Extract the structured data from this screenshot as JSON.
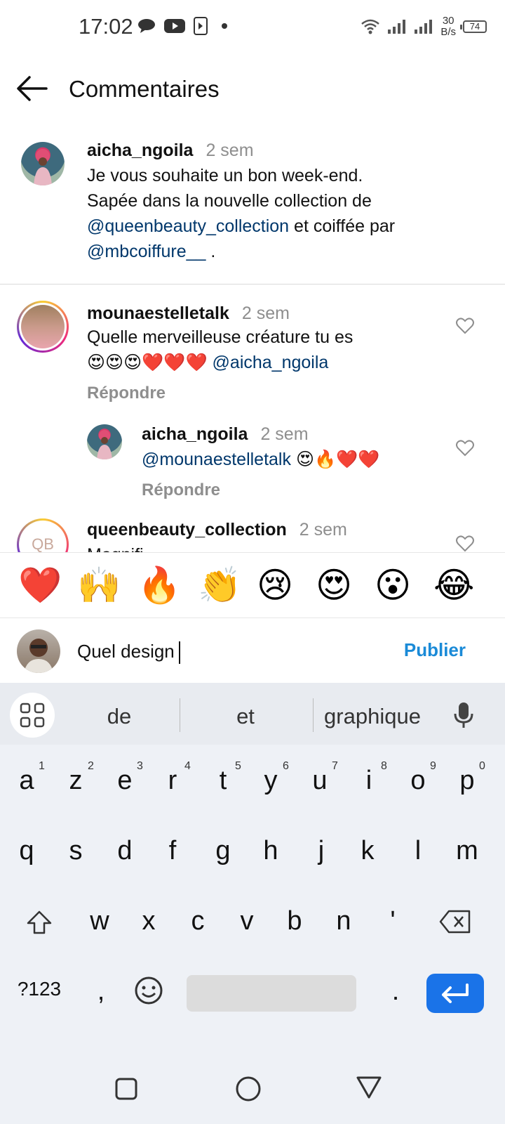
{
  "status": {
    "time": "17:02",
    "speed_top": "30",
    "speed_unit": "B/s",
    "battery": "74"
  },
  "header": {
    "title": "Commentaires"
  },
  "caption": {
    "username": "aicha_ngoila",
    "time": "2 sem",
    "line1": "Je vous souhaite un bon week-end.",
    "line2": "Sapée dans la nouvelle collection de",
    "mention1": "@queenbeauty_collection",
    "mid": " et coiffée par",
    "mention2": "@mbcoiffure__",
    "end": " ."
  },
  "comments": [
    {
      "username": "mounaestelletalk",
      "time": "2 sem",
      "text": "Quelle merveilleuse créature tu es",
      "emojis": "😍😍😍❤️❤️❤️",
      "mention": "@aicha_ngoila",
      "reply": "Répondre"
    },
    {
      "username": "aicha_ngoila",
      "time": "2 sem",
      "mention": "@mounaestelletalk",
      "emojis": "😍🔥❤️❤️",
      "reply": "Répondre"
    },
    {
      "username": "queenbeauty_collection",
      "time": "2 sem",
      "text": "Magnifi..."
    }
  ],
  "emoji_bar": [
    "❤️",
    "🙌",
    "🔥",
    "👏",
    "😢",
    "😍",
    "😮",
    "😂"
  ],
  "input": {
    "value": "Quel design",
    "publish": "Publier"
  },
  "keyboard": {
    "suggestions": [
      "de",
      "et",
      "graphique"
    ],
    "row1": [
      "a",
      "z",
      "e",
      "r",
      "t",
      "y",
      "u",
      "i",
      "o",
      "p"
    ],
    "row1_nums": [
      "1",
      "2",
      "3",
      "4",
      "5",
      "6",
      "7",
      "8",
      "9",
      "0"
    ],
    "row2": [
      "q",
      "s",
      "d",
      "f",
      "g",
      "h",
      "j",
      "k",
      "l",
      "m"
    ],
    "row3": [
      "w",
      "x",
      "c",
      "v",
      "b",
      "n",
      "'"
    ],
    "sym": "?123",
    "comma": ",",
    "period": "."
  }
}
